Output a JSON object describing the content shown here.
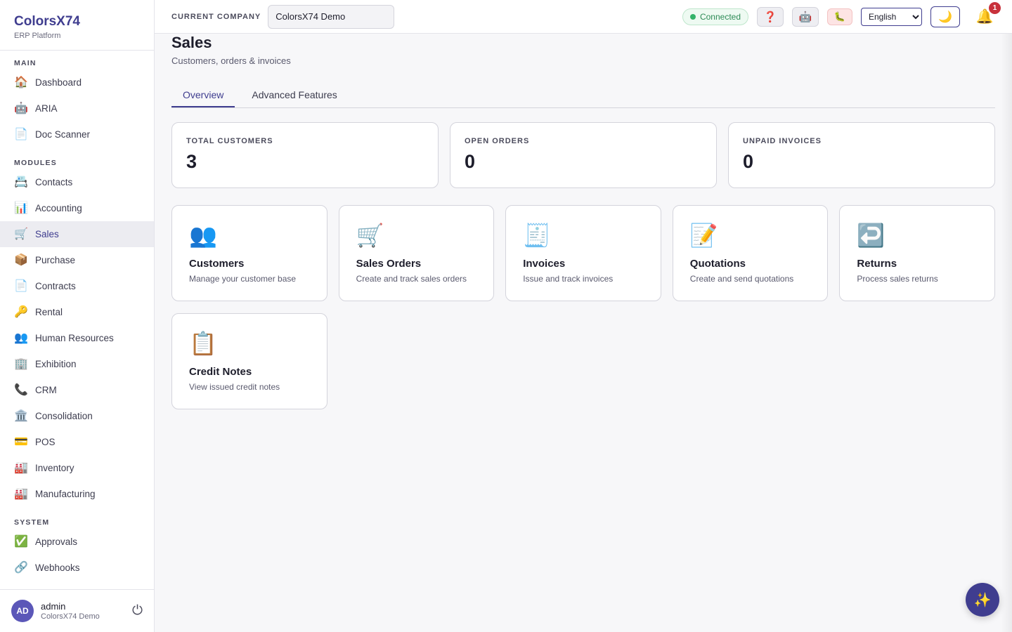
{
  "brand": {
    "name": "ColorsX74",
    "subtitle": "ERP Platform"
  },
  "sidebar": {
    "sections": [
      {
        "title": "MAIN",
        "items": [
          {
            "icon": "🏠",
            "icon_name": "house-icon",
            "label": "Dashboard"
          },
          {
            "icon": "🤖",
            "icon_name": "robot-icon",
            "label": "ARIA"
          },
          {
            "icon": "📄",
            "icon_name": "document-icon",
            "label": "Doc Scanner"
          }
        ]
      },
      {
        "title": "MODULES",
        "items": [
          {
            "icon": "📇",
            "icon_name": "card-index-icon",
            "label": "Contacts"
          },
          {
            "icon": "📊",
            "icon_name": "bar-chart-icon",
            "label": "Accounting"
          },
          {
            "icon": "🛒",
            "icon_name": "shopping-cart-icon",
            "label": "Sales",
            "active": true
          },
          {
            "icon": "📦",
            "icon_name": "package-icon",
            "label": "Purchase"
          },
          {
            "icon": "📄",
            "icon_name": "document-icon",
            "label": "Contracts"
          },
          {
            "icon": "🔑",
            "icon_name": "key-icon",
            "label": "Rental"
          },
          {
            "icon": "👥",
            "icon_name": "people-icon",
            "label": "Human Resources"
          },
          {
            "icon": "🏢",
            "icon_name": "office-building-icon",
            "label": "Exhibition"
          },
          {
            "icon": "📞",
            "icon_name": "phone-icon",
            "label": "CRM"
          },
          {
            "icon": "🏛️",
            "icon_name": "classical-building-icon",
            "label": "Consolidation"
          },
          {
            "icon": "💳",
            "icon_name": "credit-card-icon",
            "label": "POS"
          },
          {
            "icon": "🏭",
            "icon_name": "factory-icon",
            "label": "Inventory"
          },
          {
            "icon": "🏭",
            "icon_name": "factory-icon",
            "label": "Manufacturing"
          }
        ]
      },
      {
        "title": "SYSTEM",
        "items": [
          {
            "icon": "✅",
            "icon_name": "check-mark-icon",
            "label": "Approvals"
          },
          {
            "icon": "🔗",
            "icon_name": "link-icon",
            "label": "Webhooks"
          }
        ]
      }
    ]
  },
  "user": {
    "initials": "AD",
    "name": "admin",
    "company": "ColorsX74 Demo",
    "logout_icon": "⏻"
  },
  "topbar": {
    "company_label": "CURRENT COMPANY",
    "company_value": "ColorsX74 Demo",
    "status": "Connected",
    "help_icon": "❓",
    "robot_icon": "🤖",
    "bug_icon": "🐛",
    "language": "English",
    "theme_icon": "🌙",
    "bell_icon": "🔔",
    "notification_count": "1"
  },
  "page": {
    "title": "Sales",
    "subtitle": "Customers, orders & invoices"
  },
  "tabs": [
    {
      "label": "Overview",
      "active": true
    },
    {
      "label": "Advanced Features"
    }
  ],
  "stats": [
    {
      "label": "TOTAL CUSTOMERS",
      "value": "3"
    },
    {
      "label": "OPEN ORDERS",
      "value": "0"
    },
    {
      "label": "UNPAID INVOICES",
      "value": "0"
    }
  ],
  "cards": [
    {
      "icon": "👥",
      "icon_name": "people-icon",
      "title": "Customers",
      "desc": "Manage your customer base"
    },
    {
      "icon": "🛒",
      "icon_name": "shopping-cart-icon",
      "title": "Sales Orders",
      "desc": "Create and track sales orders"
    },
    {
      "icon": "🧾",
      "icon_name": "receipt-icon",
      "title": "Invoices",
      "desc": "Issue and track invoices"
    },
    {
      "icon": "📝",
      "icon_name": "memo-icon",
      "title": "Quotations",
      "desc": "Create and send quotations"
    },
    {
      "icon": "↩️",
      "icon_name": "return-arrow-icon",
      "title": "Returns",
      "desc": "Process sales returns"
    },
    {
      "icon": "📋",
      "icon_name": "clipboard-icon",
      "title": "Credit Notes",
      "desc": "View issued credit notes"
    }
  ],
  "fab_icon": "✨",
  "colors": {
    "accent": "#3f3d8f",
    "connected": "#34b36a",
    "badge": "#c8313b"
  }
}
